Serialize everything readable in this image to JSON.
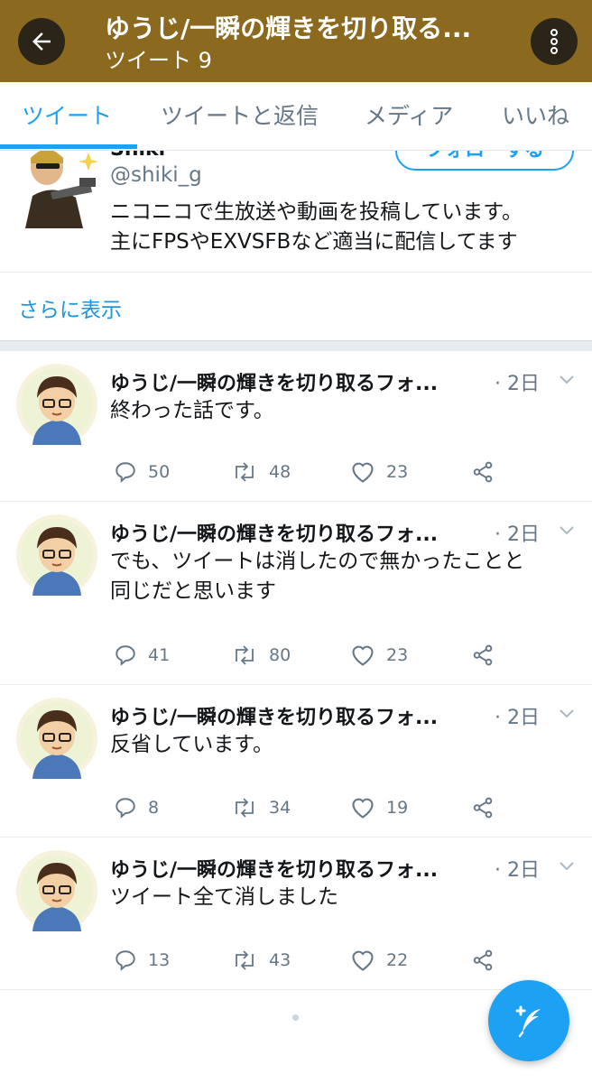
{
  "header": {
    "title": "ゆうじ/一瞬の輝きを切り取る...",
    "subtitle": "ツイート 9",
    "bg_color": "#8b6a1f"
  },
  "tabs": [
    {
      "label": "ツイート",
      "active": true
    },
    {
      "label": "ツイートと返信",
      "active": false
    },
    {
      "label": "メディア",
      "active": false
    },
    {
      "label": "いいね",
      "active": false
    }
  ],
  "profile": {
    "name": "Shiki",
    "handle": "@shiki_g",
    "follow_label": "フォローする",
    "bio_line1": "ニコニコで生放送や動画を投稿しています。",
    "bio_line2": "主にFPSやEXVSFBなど適当に配信してます"
  },
  "show_more": "さらに表示",
  "tweets": [
    {
      "name": "ゆうじ/一瞬の輝きを切り取るフォ...",
      "time": "· 2日",
      "text_line1": "終わった話です。",
      "text_line2": "",
      "replies": "50",
      "retweets": "48",
      "likes": "23"
    },
    {
      "name": "ゆうじ/一瞬の輝きを切り取るフォ...",
      "time": "· 2日",
      "text_line1": "でも、ツイートは消したので無かったことと",
      "text_line2": "同じだと思います",
      "replies": "41",
      "retweets": "80",
      "likes": "23"
    },
    {
      "name": "ゆうじ/一瞬の輝きを切り取るフォ...",
      "time": "· 2日",
      "text_line1": "反省しています。",
      "text_line2": "",
      "replies": "8",
      "retweets": "34",
      "likes": "19"
    },
    {
      "name": "ゆうじ/一瞬の輝きを切り取るフォ...",
      "time": "· 2日",
      "text_line1": "ツイート全て消しました",
      "text_line2": "",
      "replies": "13",
      "retweets": "43",
      "likes": "22"
    }
  ],
  "colors": {
    "accent": "#1da1f2",
    "secondary_text": "#657786"
  }
}
